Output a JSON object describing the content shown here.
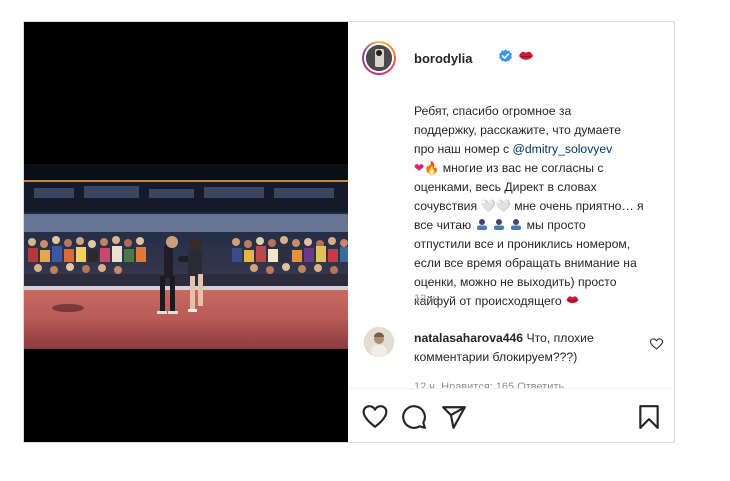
{
  "post": {
    "username": "borodylia",
    "caption": {
      "line1": "Ребят, спасибо огромное за",
      "line2": "поддержку, расскажите, что думаете",
      "line3_prefix": "про наш номер с ",
      "mention": "@dmitry_solovyev",
      "line4_emoji_heart": "❤",
      "line4_emoji_fire": "🔥",
      "line4_text": " многие из вас не согласны с",
      "line5": "оценками, весь Директ в словах",
      "line6": "сочувствия 🤍🤍 мне очень приятно… я",
      "line7_prefix": "все читаю ",
      "line7_suffix": " мы просто",
      "line8": "отпустили все и прониклись номером,",
      "line9": "если все время обращать внимание на",
      "line10": "оценки, можно не выходить) просто",
      "line11": "кайфуй от происходящего "
    },
    "timestamp": "12 ч."
  },
  "comment": {
    "username": "natalasaharova446",
    "text": " Что, плохие комментарии блокируем???)",
    "meta": "12 ч.   Нравится: 165   Ответить"
  },
  "icons": {
    "verified": "verified-badge-icon",
    "lips": "lips-emoji-icon",
    "like": "heart-icon",
    "comment": "comment-bubble-icon",
    "share": "paper-plane-icon",
    "save": "bookmark-icon"
  },
  "colors": {
    "border": "#dbdbdb",
    "text": "#262626",
    "muted": "#8e8e8e",
    "mention": "#00376b",
    "verified": "#3897f0"
  }
}
